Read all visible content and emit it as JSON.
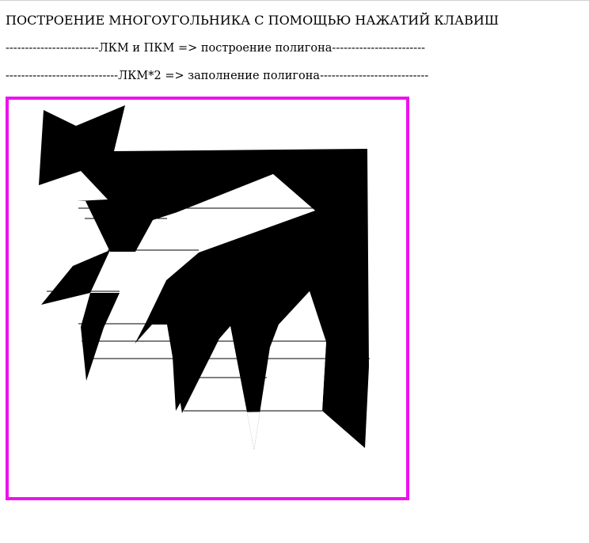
{
  "page": {
    "title": "ПОСТРОЕНИЕ МНОГОУГОЛЬНИКА С ПОМОЩЬЮ НАЖАТИЙ КЛАВИШ",
    "hint_build": "------------------------ЛКМ и ПКМ => построение полигона------------------------",
    "hint_fill": "-----------------------------ЛКМ*2 => заполнение полигона----------------------------"
  },
  "canvas": {
    "border_color": "#ee11ee",
    "fill_color": "#000000",
    "background_color": "#ffffff"
  }
}
